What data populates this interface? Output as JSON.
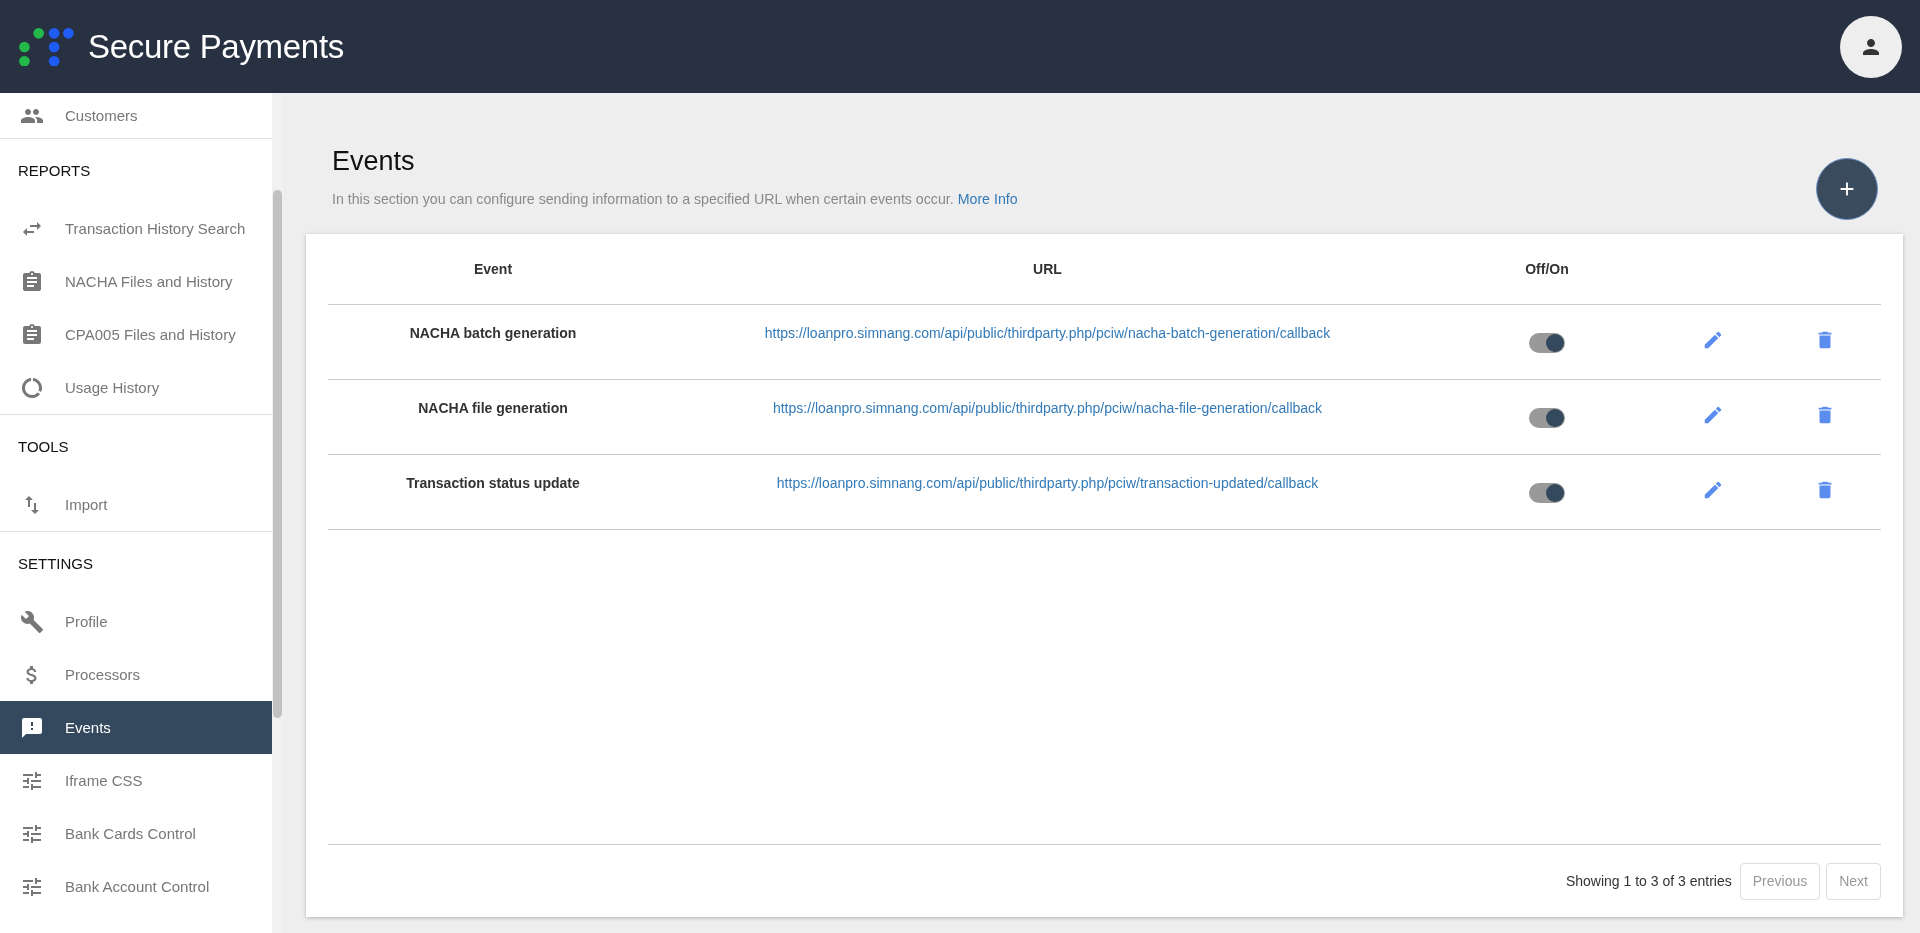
{
  "header": {
    "brand": "Secure Payments"
  },
  "sidebar": {
    "groups": [
      {
        "items": [
          {
            "label": "Customers",
            "selected": false
          }
        ]
      },
      {
        "title": "REPORTS",
        "items": [
          {
            "label": "Transaction History Search",
            "selected": false
          },
          {
            "label": "NACHA Files and History",
            "selected": false
          },
          {
            "label": "CPA005 Files and History",
            "selected": false
          },
          {
            "label": "Usage History",
            "selected": false
          }
        ]
      },
      {
        "title": "TOOLS",
        "items": [
          {
            "label": "Import",
            "selected": false
          }
        ]
      },
      {
        "title": "SETTINGS",
        "items": [
          {
            "label": "Profile",
            "selected": false
          },
          {
            "label": "Processors",
            "selected": false
          },
          {
            "label": "Events",
            "selected": true
          },
          {
            "label": "Iframe CSS",
            "selected": false
          },
          {
            "label": "Bank Cards Control",
            "selected": false
          },
          {
            "label": "Bank Account Control",
            "selected": false
          }
        ]
      }
    ]
  },
  "page": {
    "title": "Events",
    "description": "In this section you can configure sending information to a specified URL when certain events occur.",
    "more_link": "More Info"
  },
  "table": {
    "columns": [
      "Event",
      "URL",
      "Off/On"
    ],
    "rows": [
      {
        "event": "NACHA batch generation",
        "url": "https://loanpro.simnang.com/api/public/thirdparty.php/pciw/nacha-batch-generation/callback",
        "on": true
      },
      {
        "event": "NACHA file generation",
        "url": "https://loanpro.simnang.com/api/public/thirdparty.php/pciw/nacha-file-generation/callback",
        "on": true
      },
      {
        "event": "Transaction status update",
        "url": "https://loanpro.simnang.com/api/public/thirdparty.php/pciw/transaction-updated/callback",
        "on": true
      }
    ]
  },
  "pagination": {
    "info": "Showing 1 to 3 of 3 entries",
    "buttons": [
      {
        "label": "Previous",
        "disabled": true
      },
      {
        "label": "Next",
        "disabled": true
      }
    ]
  }
}
